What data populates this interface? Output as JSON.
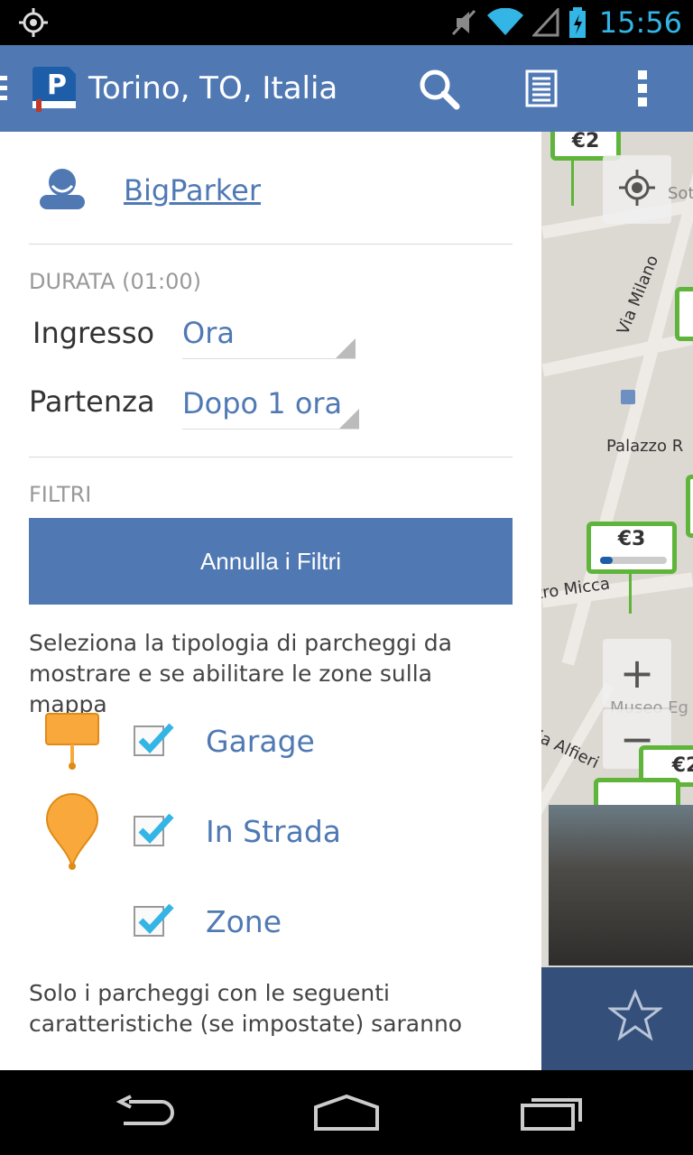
{
  "status_bar": {
    "time": "15:56",
    "icons": [
      "location-icon",
      "mute-icon",
      "wifi-icon",
      "signal-icon",
      "battery-charging-icon"
    ]
  },
  "action_bar": {
    "title": "Torino, TO, Italia",
    "icons": [
      "app-parking-logo",
      "search-icon",
      "list-icon",
      "overflow-menu-icon"
    ]
  },
  "drawer": {
    "user_name": "BigParker",
    "durata_title": "DURATA (01:00)",
    "ingresso_label": "Ingresso",
    "ingresso_value": "Ora",
    "partenza_label": "Partenza",
    "partenza_value": "Dopo 1 ora",
    "filtri_title": "FILTRI",
    "reset_button": "Annulla i Filtri",
    "filters_desc": "Seleziona la tipologia di parcheggi da mostrare e se abilitare le zone sulla mappa",
    "types": [
      {
        "label": "Garage",
        "checked": true,
        "icon": "garage-pin-icon"
      },
      {
        "label": "In Strada",
        "checked": true,
        "icon": "street-pin-icon"
      },
      {
        "label": "Zone",
        "checked": true,
        "icon": ""
      }
    ],
    "features_desc": "Solo i parcheggi con le seguenti caratteristiche (se impostate) saranno"
  },
  "map": {
    "price_top": "€2",
    "price_mid": "€3",
    "price_right": "€2",
    "label_via_milano": "Via Milano",
    "label_palazzo": "Palazzo R",
    "label_micca": "tro Micca",
    "label_museo": "Museo Eg",
    "label_alfieri": "ia Alfieri",
    "label_sotto": "Sotto",
    "zoom_in": "+",
    "zoom_out": "−"
  },
  "colors": {
    "accent": "#5079b4",
    "status_icons": "#33b5e5",
    "pin_orange": "#f9a93b",
    "map_pin_green": "#5fb53a"
  }
}
